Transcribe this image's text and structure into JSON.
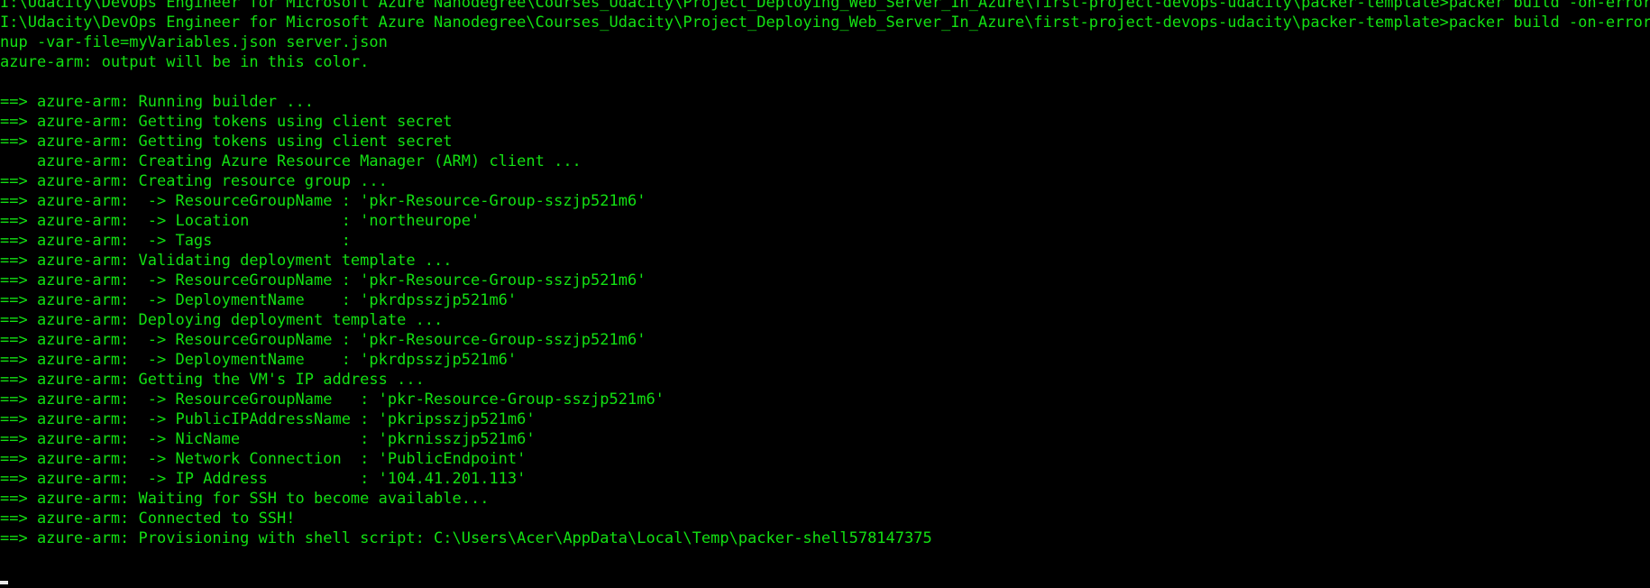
{
  "terminal": {
    "colors": {
      "background": "#000000",
      "text": "#13e013",
      "cursor": "#e8e8e8"
    },
    "lines": [
      "I:\\Udacity\\DevOps Engineer for Microsoft Azure Nanodegree\\Courses_Udacity\\Project_Deploying_Web_Server_In_Azure\\first-project-devops-udacity\\packer-template>packer build -on-error=cle",
      "I:\\Udacity\\DevOps Engineer for Microsoft Azure Nanodegree\\Courses_Udacity\\Project_Deploying_Web_Server_In_Azure\\first-project-devops-udacity\\packer-template>packer build -on-error=cle",
      "nup -var-file=myVariables.json server.json",
      "azure-arm: output will be in this color.",
      "",
      "==> azure-arm: Running builder ...",
      "==> azure-arm: Getting tokens using client secret",
      "==> azure-arm: Getting tokens using client secret",
      "    azure-arm: Creating Azure Resource Manager (ARM) client ...",
      "==> azure-arm: Creating resource group ...",
      "==> azure-arm:  -> ResourceGroupName : 'pkr-Resource-Group-sszjp521m6'",
      "==> azure-arm:  -> Location          : 'northeurope'",
      "==> azure-arm:  -> Tags              :",
      "==> azure-arm: Validating deployment template ...",
      "==> azure-arm:  -> ResourceGroupName : 'pkr-Resource-Group-sszjp521m6'",
      "==> azure-arm:  -> DeploymentName    : 'pkrdpsszjp521m6'",
      "==> azure-arm: Deploying deployment template ...",
      "==> azure-arm:  -> ResourceGroupName : 'pkr-Resource-Group-sszjp521m6'",
      "==> azure-arm:  -> DeploymentName    : 'pkrdpsszjp521m6'",
      "==> azure-arm: Getting the VM's IP address ...",
      "==> azure-arm:  -> ResourceGroupName   : 'pkr-Resource-Group-sszjp521m6'",
      "==> azure-arm:  -> PublicIPAddressName : 'pkripsszjp521m6'",
      "==> azure-arm:  -> NicName             : 'pkrnisszjp521m6'",
      "==> azure-arm:  -> Network Connection  : 'PublicEndpoint'",
      "==> azure-arm:  -> IP Address          : '104.41.201.113'",
      "==> azure-arm: Waiting for SSH to become available...",
      "==> azure-arm: Connected to SSH!",
      "==> azure-arm: Provisioning with shell script: C:\\Users\\Acer\\AppData\\Local\\Temp\\packer-shell578147375",
      ""
    ]
  }
}
